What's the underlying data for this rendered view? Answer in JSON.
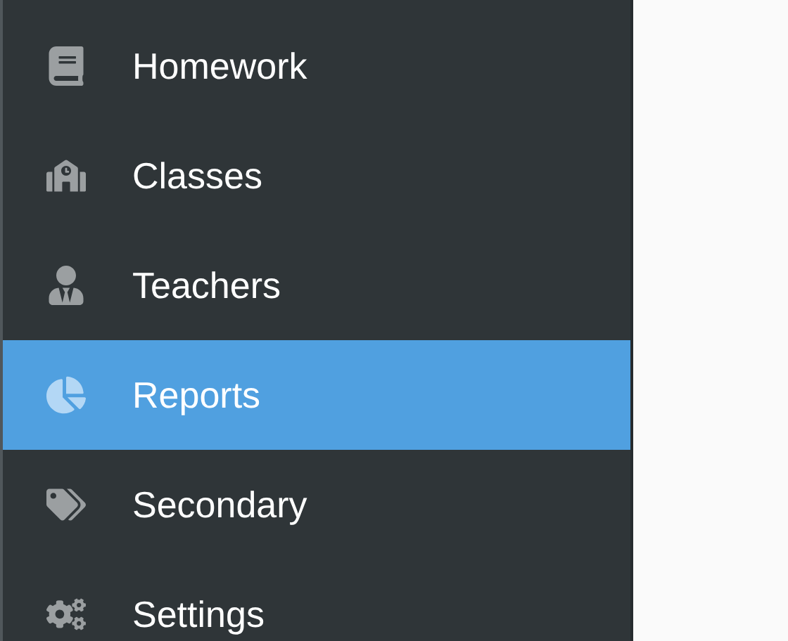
{
  "sidebar": {
    "items": [
      {
        "label": "Homework",
        "selected": false
      },
      {
        "label": "Classes",
        "selected": false
      },
      {
        "label": "Teachers",
        "selected": false
      },
      {
        "label": "Reports",
        "selected": true
      },
      {
        "label": "Secondary",
        "selected": false
      },
      {
        "label": "Settings",
        "selected": false
      }
    ]
  }
}
